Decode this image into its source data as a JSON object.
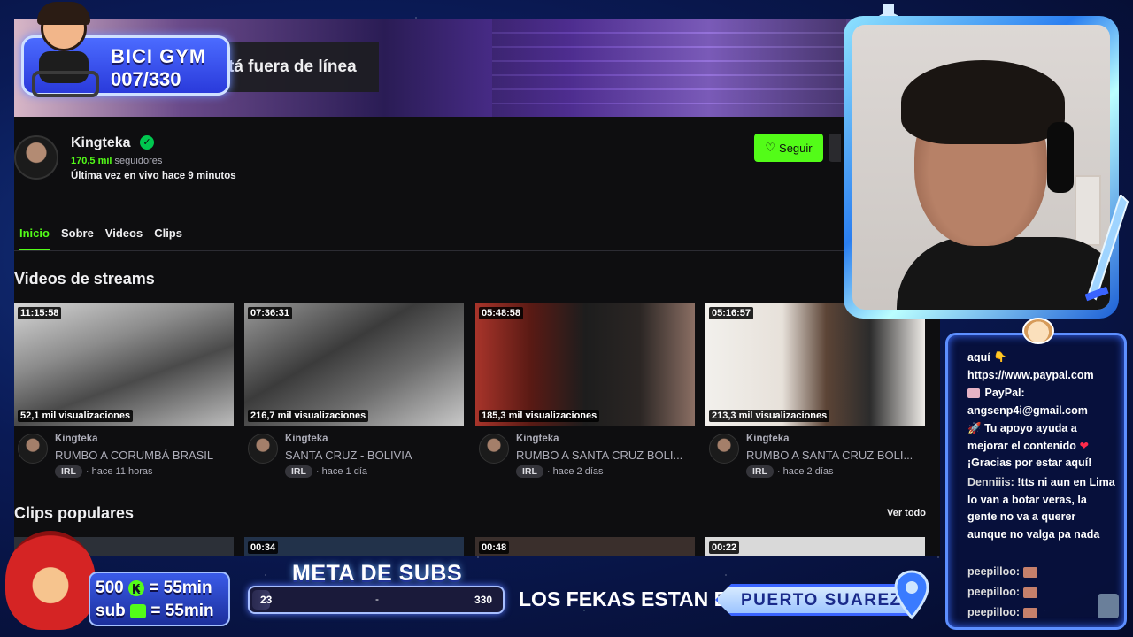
{
  "overlay": {
    "bici_gym_title": "BICI GYM",
    "bici_gym_count": "007/330",
    "subs_line1_amount": "500",
    "subs_line1_value": "= 55min",
    "subs_line2_label": "sub",
    "subs_line2_value": "= 55min",
    "meta_title": "META DE SUBS",
    "meta_current": "23",
    "meta_sep": "-",
    "meta_goal": "330",
    "location_label": "LOS FEKAS ESTAN EN:",
    "location_value": "PUERTO SUAREZ"
  },
  "channel": {
    "offline_text": "tá fuera de línea",
    "name": "Kingteka",
    "followers_count": "170,5 mil",
    "followers_label": "seguidores",
    "last_live": "Última vez en vivo hace 9 minutos",
    "follow_label": "Seguir"
  },
  "tabs": [
    {
      "label": "Inicio",
      "active": true
    },
    {
      "label": "Sobre"
    },
    {
      "label": "Videos"
    },
    {
      "label": "Clips"
    }
  ],
  "sections": {
    "streams_title": "Videos de streams",
    "clips_title": "Clips populares",
    "see_all": "Ver todo"
  },
  "videos": [
    {
      "duration": "11:15:58",
      "views": "52,1 mil visualizaciones",
      "channel": "Kingteka",
      "title": "RUMBO A CORUMBÁ BRASIL",
      "tag": "IRL",
      "age": "· hace 11 horas"
    },
    {
      "duration": "07:36:31",
      "views": "216,7 mil visualizaciones",
      "channel": "Kingteka",
      "title": "SANTA CRUZ - BOLIVIA",
      "tag": "IRL",
      "age": "· hace 1 día"
    },
    {
      "duration": "05:48:58",
      "views": "185,3 mil visualizaciones",
      "channel": "Kingteka",
      "title": "RUMBO A SANTA CRUZ BOLI...",
      "tag": "IRL",
      "age": "· hace 2 días"
    },
    {
      "duration": "05:16:57",
      "views": "213,3 mil visualizaciones",
      "channel": "Kingteka",
      "title": "RUMBO A SANTA CRUZ BOLI...",
      "tag": "IRL",
      "age": "· hace 2 días"
    }
  ],
  "clips": [
    {
      "duration": ""
    },
    {
      "duration": "00:34"
    },
    {
      "duration": "00:48"
    },
    {
      "duration": "00:22"
    }
  ],
  "chat": {
    "msg1": "aquí 👇",
    "msg2": "https://www.paypal.com",
    "msg3_prefix": "PayPal:",
    "msg3_email": "angsenp4i@gmail.com",
    "msg4": "Tu apoyo ayuda a mejorar el contenido",
    "msg5": "¡Gracias por estar aquí!",
    "msg6_user": "Denniiis:",
    "msg6_text": "!tts ni aun en Lima lo van a botar veras, la gente no va a querer aunque no valga pa nada",
    "msg7_user": "peepilloo:",
    "msg8_user": "peepilloo:",
    "msg9_user": "peepilloo:"
  },
  "colors": {
    "accent": "#53fc18",
    "page_bg": "#0e0e10",
    "overlay_blue": "#3a5be8"
  }
}
